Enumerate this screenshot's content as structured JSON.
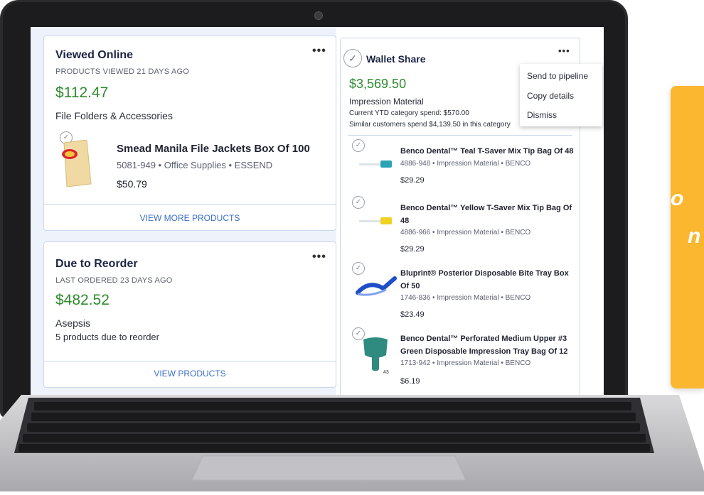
{
  "viewed_online": {
    "title": "Viewed Online",
    "caption": "PRODUCTS VIEWED 21 DAYS AGO",
    "amount": "$112.47",
    "category": "File Folders & Accessories",
    "product": {
      "name": "Smead Manila File Jackets Box Of 100",
      "meta": "5081-949 • Office Supplies • ESSEND",
      "price": "$50.79"
    },
    "link": "VIEW MORE PRODUCTS",
    "more": "•••"
  },
  "due_to_reorder": {
    "title": "Due to Reorder",
    "caption": "LAST ORDERED 23 DAYS AGO",
    "amount": "$482.52",
    "category": "Asepsis",
    "detail": "5 products due to reorder",
    "link": "VIEW PRODUCTS",
    "more": "•••"
  },
  "wallet_share": {
    "title": "Wallet Share",
    "amount": "$3,569.50",
    "category": "Impression Material",
    "current_spend": "Current YTD category spend: $570.00",
    "similar_spend": "Similar customers spend $4,139.50 in this category",
    "more": "•••",
    "menu": [
      "Send to pipeline",
      "Copy details",
      "Dismiss"
    ],
    "products": [
      {
        "name1": "Benco Dental™ Teal T-Saver Mix Tip Bag Of 48",
        "name2": "",
        "meta": "4886-948 • Impression Material • BENCO",
        "price": "$29.29"
      },
      {
        "name1": "Benco Dental™ Yellow T-Saver Mix Tip Bag Of",
        "name2": "48",
        "meta": "4886-966 • Impression Material • BENCO",
        "price": "$29.29"
      },
      {
        "name1": "Bluprint® Posterior Disposable Bite Tray Box",
        "name2": "Of 50",
        "meta": "1746-836 • Impression Material • BENCO",
        "price": "$23.49"
      },
      {
        "name1": "Benco Dental™ Perforated Medium Upper #3",
        "name2": "Green Disposable Impression Tray Bag Of 12",
        "meta": "1713-942 • Impression Material • BENCO",
        "price": "$6.19"
      }
    ]
  },
  "side_text": {
    "line1": "o",
    "line2": "n"
  },
  "colors": {
    "accent_green": "#2e8b2e",
    "link_blue": "#3b6fc7",
    "promo_orange": "#fbb72f"
  }
}
